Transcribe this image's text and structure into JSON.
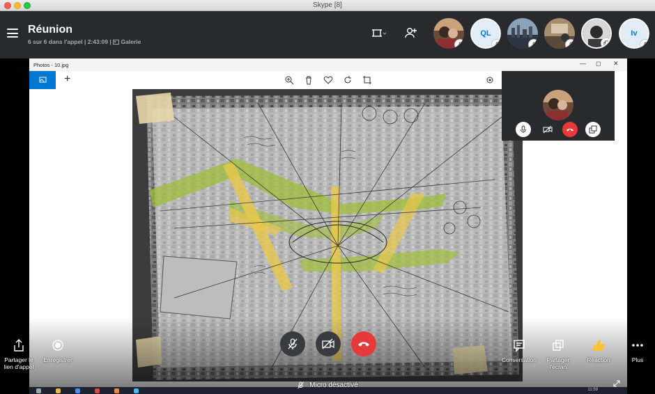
{
  "window": {
    "title": "Skype [8]"
  },
  "meeting": {
    "title": "Réunion",
    "participants_count": "6 sur 6 dans l'appel",
    "separator": "|",
    "duration": "2:43:09",
    "view_label": "Galerie"
  },
  "participants": [
    {
      "type": "photo",
      "name_icon": "participant-photo-1"
    },
    {
      "type": "initials",
      "initials": "QL"
    },
    {
      "type": "photo",
      "name_icon": "participant-photo-city"
    },
    {
      "type": "photo",
      "name_icon": "participant-photo-room"
    },
    {
      "type": "photo",
      "name_icon": "participant-photo-bw"
    },
    {
      "type": "initials",
      "initials": "Iv"
    }
  ],
  "photos_app": {
    "title": "Photos - 10.jpg",
    "window_controls": [
      "—",
      "◻",
      "✕"
    ]
  },
  "controls": {
    "share_link": "Partager le lien d'appel",
    "record": "Enregistrer",
    "conversation": "Conversation",
    "share_screen": "Partager l'écran",
    "reaction": "Réaction",
    "more": "Plus"
  },
  "status": {
    "mic": "Micro désactivé"
  },
  "taskbar": {
    "time": "11:59"
  },
  "colors": {
    "header_bg": "#292a2e",
    "accent_blue": "#0078d4",
    "hangup_red": "#e6393a",
    "sketch_yellow": "#e8c84a",
    "sketch_green": "#9fbf3a"
  }
}
